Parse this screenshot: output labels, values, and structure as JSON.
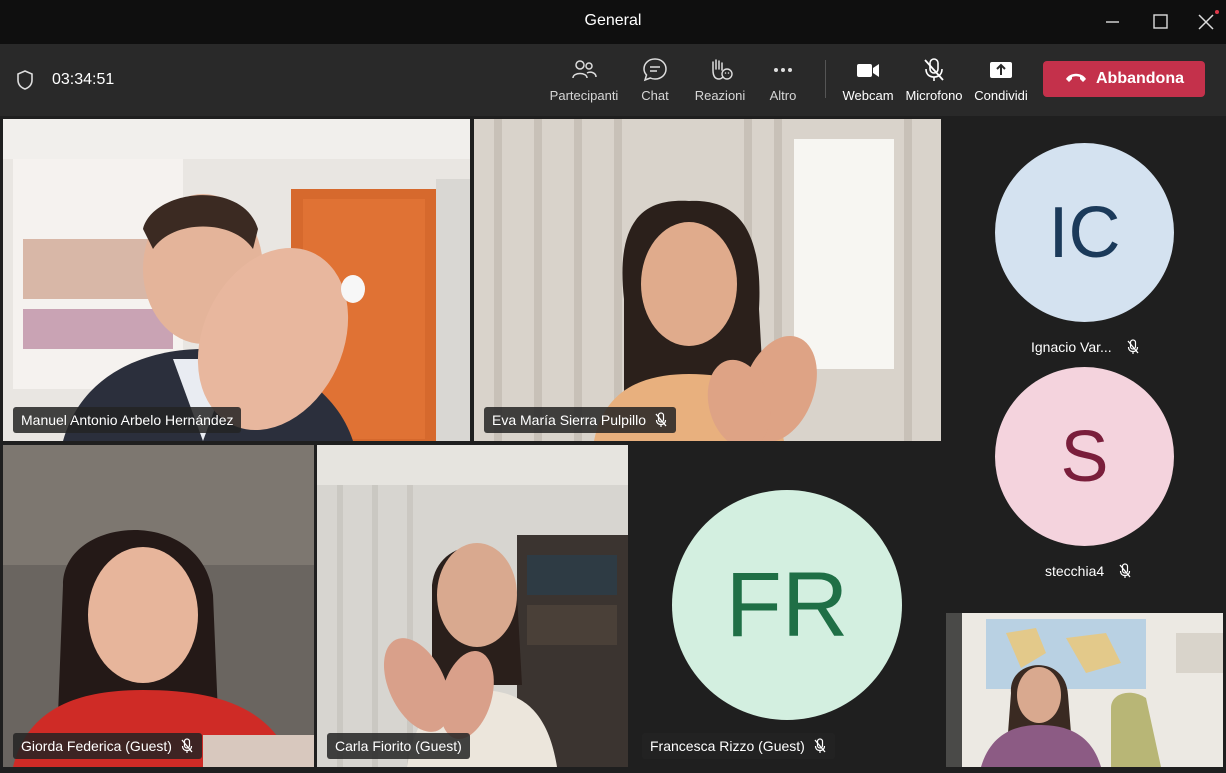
{
  "window": {
    "title": "General"
  },
  "toolbar": {
    "timer": "03:34:51",
    "buttons": {
      "participants": "Partecipanti",
      "chat": "Chat",
      "reactions": "Reazioni",
      "more": "Altro",
      "webcam": "Webcam",
      "microphone": "Microfono",
      "share": "Condividi"
    },
    "leave_label": "Abbandona"
  },
  "participants": {
    "manuel": {
      "name": "Manuel Antonio Arbelo Hernández"
    },
    "eva": {
      "name": "Eva María Sierra Pulpillo"
    },
    "giorda": {
      "name": "Giorda Federica (Guest)"
    },
    "carla": {
      "name": "Carla Fiorito (Guest)"
    },
    "francesca": {
      "name": "Francesca Rizzo (Guest)",
      "initials": "FR"
    },
    "ignacio": {
      "name": "Ignacio Var...",
      "initials": "IC"
    },
    "stecchia": {
      "name": "stecchia4",
      "initials": "S"
    }
  },
  "colors": {
    "leave": "#c4314b",
    "fr_avatar_bg": "#d3efe0",
    "fr_avatar_fg": "#1f6f46",
    "ic_avatar_bg": "#d4e2f0",
    "ic_avatar_fg": "#1b3a5a",
    "s_avatar_bg": "#f4d3dd",
    "s_avatar_fg": "#7a1e3b"
  }
}
